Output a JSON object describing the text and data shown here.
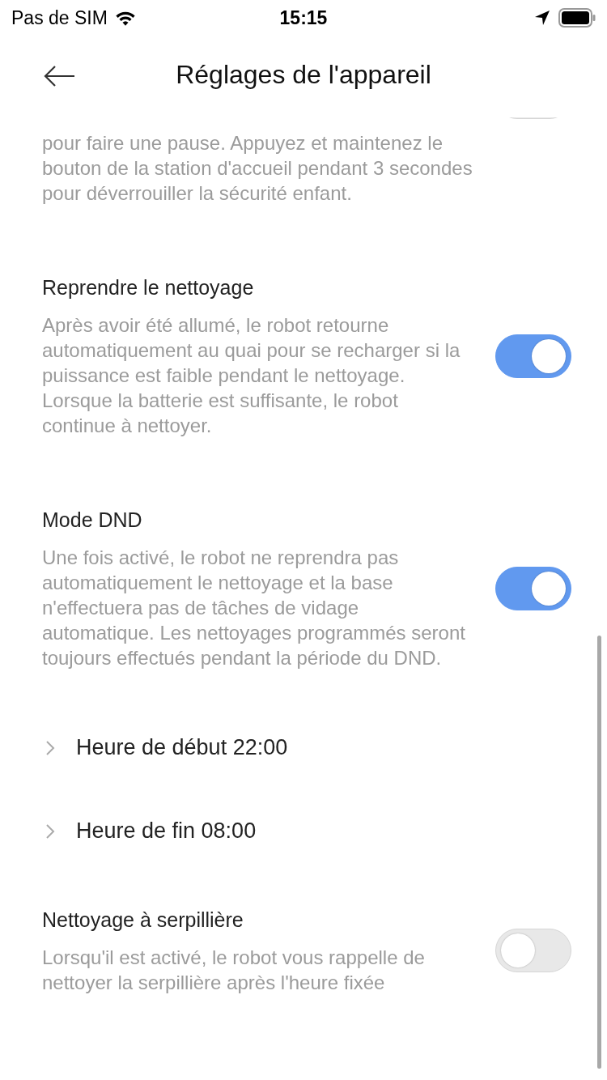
{
  "status_bar": {
    "carrier": "Pas de SIM",
    "time": "15:15"
  },
  "header": {
    "title": "Réglages de l'appareil"
  },
  "settings": [
    {
      "kind": "toggle",
      "description": "pour faire une pause. Appuyez et maintenez le bouton de la station d'accueil pendant 3 secondes pour déverrouiller la sécurité enfant.",
      "on": false
    },
    {
      "kind": "toggle",
      "title": "Reprendre le nettoyage",
      "description": "Après avoir été allumé, le robot retourne automatiquement au quai pour se recharger si la puissance est faible pendant le nettoyage. Lorsque la batterie est suffisante, le robot continue à nettoyer.",
      "on": true
    },
    {
      "kind": "toggle",
      "title": "Mode DND",
      "description": "Une fois activé, le robot ne reprendra pas automatiquement le nettoyage et la base n'effectuera pas de tâches de vidage automatique. Les nettoyages programmés seront toujours effectués pendant la période du DND.",
      "on": true
    },
    {
      "kind": "link",
      "title": "Heure de début 22:00"
    },
    {
      "kind": "link",
      "title": "Heure de fin 08:00"
    },
    {
      "kind": "toggle",
      "title": "Nettoyage à serpillière",
      "description": "Lorsqu'il est activé, le robot vous rappelle de nettoyer la serpillière après l'heure fixée",
      "on": false
    }
  ]
}
